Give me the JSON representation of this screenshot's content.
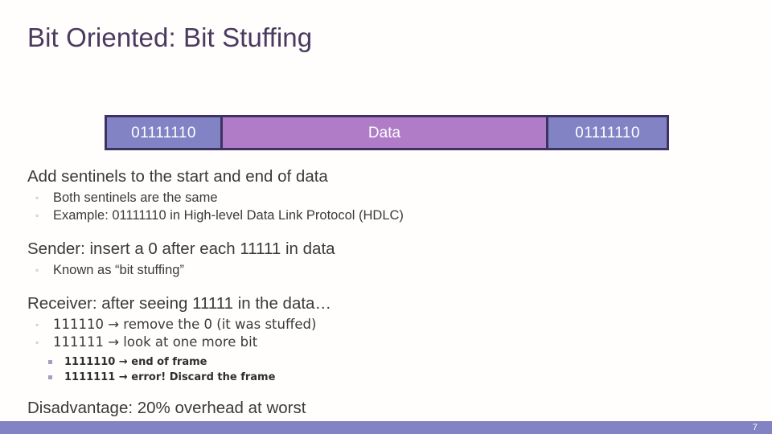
{
  "slide": {
    "title": "Bit Oriented: Bit Stuffing",
    "page_number": "7",
    "colors": {
      "title": "#4a3a5e",
      "sentinel_fill": "#8183c4",
      "data_fill": "#b07cc8",
      "frame_border": "#3d3363",
      "footer_bar": "#8183c4",
      "lvl3_marker": "#a99cc0",
      "body_text": "#3a3a3a"
    }
  },
  "diagram": {
    "sentinel_left": "01111110",
    "data": "Data",
    "sentinel_right": "01111110"
  },
  "content": {
    "blocks": [
      {
        "heading": "Add sentinels to the start and end of data",
        "sub": [
          "Both sentinels are the same",
          "Example: 01111110 in High-level Data Link Protocol (HDLC)"
        ],
        "sub_marker": "◦"
      },
      {
        "heading": "Sender: insert a 0 after each 11111 in data",
        "sub": [
          "Known as “bit stuffing”"
        ],
        "sub_marker": "◦"
      },
      {
        "heading": "Receiver: after seeing 11111 in the data…",
        "sub": [
          "111110 → remove the 0 (it was stuffed)",
          "111111 → look at one more bit"
        ],
        "sub_marker": "◦",
        "sub_sub": [
          "1111110 → end of frame",
          "1111111 → error! Discard the frame"
        ]
      },
      {
        "heading": "Disadvantage: 20% overhead at worst",
        "sub": []
      }
    ]
  }
}
